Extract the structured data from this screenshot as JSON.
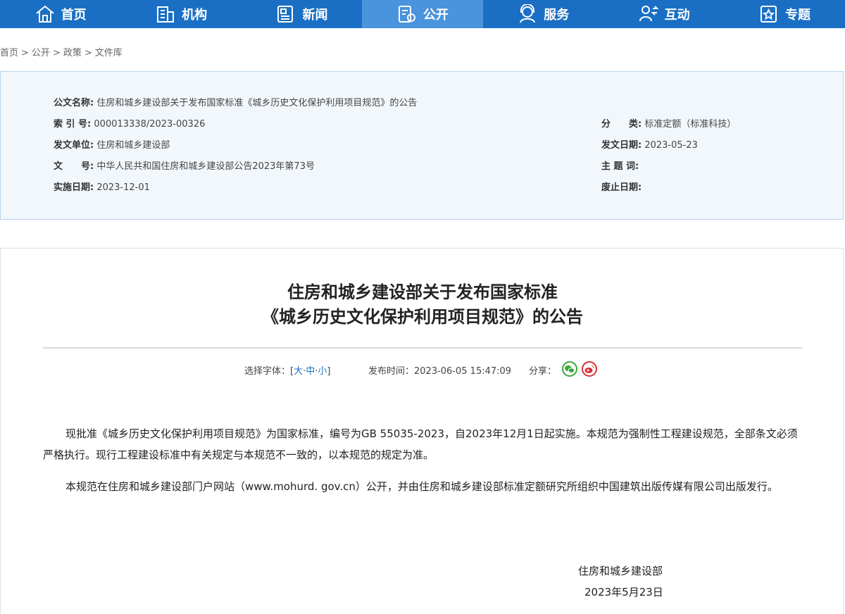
{
  "nav": {
    "items": [
      {
        "label": "首页",
        "icon": "home-icon"
      },
      {
        "label": "机构",
        "icon": "building-icon"
      },
      {
        "label": "新闻",
        "icon": "news-icon"
      },
      {
        "label": "公开",
        "icon": "open-doc-icon",
        "active": true
      },
      {
        "label": "服务",
        "icon": "service-icon"
      },
      {
        "label": "互动",
        "icon": "interaction-icon"
      },
      {
        "label": "专题",
        "icon": "topic-icon"
      }
    ],
    "bg_color": "#1a6fc4",
    "active_color": "#4a93dd"
  },
  "breadcrumb": [
    "首页",
    "公开",
    "政策",
    "文件库"
  ],
  "info": {
    "doc_name_label": "公文名称:",
    "doc_name": "住房和城乡建设部关于发布国家标准《城乡历史文化保护利用项目规范》的公告",
    "index_label": "索 引 号:",
    "index": "000013338/2023-00326",
    "category_label": "分　　类:",
    "category": "标准定额（标准科技）",
    "issuer_label": "发文单位:",
    "issuer": "住房和城乡建设部",
    "issue_date_label": "发文日期:",
    "issue_date": "2023-05-23",
    "doc_no_label": "文　　号:",
    "doc_no": "中华人民共和国住房和城乡建设部公告2023年第73号",
    "keywords_label": "主 题 词:",
    "keywords": "",
    "effective_label": "实施日期:",
    "effective": "2023-12-01",
    "abolish_label": "废止日期:",
    "abolish": ""
  },
  "article": {
    "title_line1": "住房和城乡建设部关于发布国家标准",
    "title_line2": "《城乡历史文化保护利用项目规范》的公告",
    "font_label": "选择字体：[",
    "font_large": "大",
    "font_medium": "中",
    "font_small": "小",
    "font_close": "]",
    "font_sep": "·",
    "publish_label": "发布时间：2023-06-05 15:47:09",
    "share_label": "分享：",
    "para1": "现批准《城乡历史文化保护利用项目规范》为国家标准，编号为GB 55035-2023，自2023年12月1日起实施。本规范为强制性工程建设规范，全部条文必须严格执行。现行工程建设标准中有关规定与本规范不一致的，以本规范的规定为准。",
    "para2": "本规范在住房和城乡建设部门户网站（www.mohurd. gov.cn）公开，并由住房和城乡建设部标准定额研究所组织中国建筑出版传媒有限公司出版发行。",
    "sign_org": "住房和城乡建设部",
    "sign_date": "2023年5月23日"
  }
}
